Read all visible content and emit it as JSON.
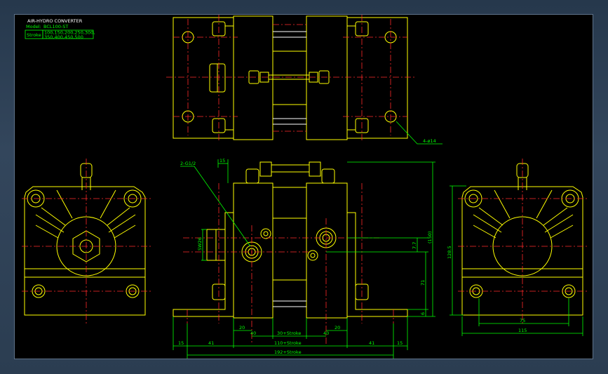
{
  "title_block": {
    "title": "AIR-HYDRO CONVERTER",
    "model_label": "Model:",
    "model_value": "BCL100-ST",
    "stroke_label": "Stroke",
    "stroke_line1": "100,150,200,250,300,",
    "stroke_line2": "350,400,450,500"
  },
  "annotations": {
    "holes": "4-ø14",
    "port": "2-G1/2",
    "port_offset": "15",
    "hex": "SW26"
  },
  "dims_front": {
    "d20a": "20",
    "d40a": "40",
    "d30s": "30+Stroke",
    "d40b": "40",
    "d20b": "20",
    "d15a": "15",
    "d41a": "41",
    "d110s": "110+Stroke",
    "d41b": "41",
    "d15b": "15",
    "d192s": "192+Stroke",
    "v77": "7.7",
    "v150": "(150)",
    "v71": "71",
    "v6": "6"
  },
  "dims_side": {
    "h1285": "128.5",
    "w75": "75",
    "w115": "115"
  },
  "colors": {
    "outline": "#ffff00",
    "centerline": "#ff2a2a",
    "dimension": "#00ff00",
    "text": "#ffffff",
    "background": "#000000"
  }
}
